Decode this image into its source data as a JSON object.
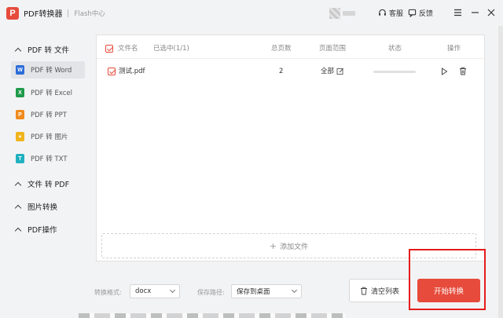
{
  "titlebar": {
    "logo_letter": "P",
    "app_name": "PDF转换器",
    "subtitle": "Flash中心",
    "support_label": "客服",
    "feedback_label": "反馈"
  },
  "sidebar": {
    "groups": [
      {
        "label": "PDF 转 文件"
      },
      {
        "label": "文件 转 PDF"
      },
      {
        "label": "图片转换"
      },
      {
        "label": "PDF操作"
      }
    ],
    "items": [
      {
        "label": "PDF 转 Word",
        "icon_letter": "W",
        "color": "#2b6cd8",
        "active": true
      },
      {
        "label": "PDF 转 Excel",
        "icon_letter": "X",
        "color": "#1e9a4b",
        "active": false
      },
      {
        "label": "PDF 转 PPT",
        "icon_letter": "P",
        "color": "#f08a1c",
        "active": false
      },
      {
        "label": "PDF 转 图片",
        "icon_letter": "▲",
        "color": "#f0b41c",
        "active": false
      },
      {
        "label": "PDF 转 TXT",
        "icon_letter": "T",
        "color": "#1fb1c0",
        "active": false
      }
    ]
  },
  "table": {
    "header": {
      "file_name": "文件名",
      "selected": "已选中(1/1)",
      "total_pages": "总页数",
      "page_range": "页面范围",
      "status": "状态",
      "actions": "操作"
    },
    "rows": [
      {
        "file_name": "测试.pdf",
        "total_pages": "2",
        "page_range": "全部",
        "progress": 0,
        "checked": true
      }
    ],
    "add_file_label": "添加文件"
  },
  "bottom": {
    "format_label": "转换格式:",
    "format_value": "docx",
    "path_label": "保存路径:",
    "path_value": "保存到桌面",
    "clear_label": "清空列表",
    "start_label": "开始转换"
  },
  "colors": {
    "accent": "#e64b3b",
    "highlight_box": "#e51c1c"
  }
}
